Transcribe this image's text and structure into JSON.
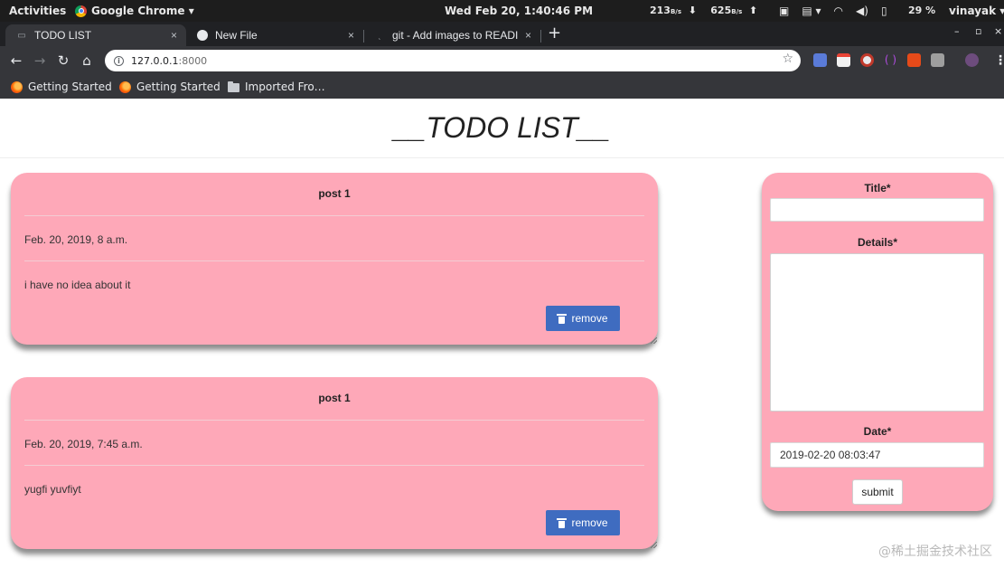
{
  "os_bar": {
    "activities": "Activities",
    "app_name": "Google Chrome ▾",
    "clock": "Wed Feb 20,  1:40:46 PM",
    "net_down": "213",
    "net_up": "625",
    "net_unit": "B/s",
    "battery": "29 %",
    "user": "vinayak ▾"
  },
  "tabs": [
    {
      "label": "TODO LIST",
      "icon": "page-icon",
      "close": "×"
    },
    {
      "label": "New File",
      "icon": "github-icon",
      "close": "×"
    },
    {
      "label": "git - Add images to READI",
      "icon": "loading-icon",
      "close": "×"
    }
  ],
  "new_tab": "+",
  "address_bar": {
    "url_host": "127.0.0.1",
    "url_port": ":8000"
  },
  "bookmarks": [
    {
      "label": "Getting Started",
      "icon": "firefox-icon"
    },
    {
      "label": "Getting Started",
      "icon": "firefox-icon"
    },
    {
      "label": "Imported Fro…",
      "icon": "folder-icon"
    }
  ],
  "page": {
    "title": "__TODO LIST__"
  },
  "posts": [
    {
      "title": "post 1",
      "date": "Feb. 20, 2019, 8 a.m.",
      "details": "i have no idea about it",
      "remove_label": "remove"
    },
    {
      "title": "post 1",
      "date": "Feb. 20, 2019, 7:45 a.m.",
      "details": "yugfi yuvfiyt",
      "remove_label": "remove"
    }
  ],
  "form": {
    "title_label": "Title*",
    "title_value": "",
    "details_label": "Details*",
    "details_value": "",
    "date_label": "Date*",
    "date_value": "2019-02-20 08:03:47",
    "submit_label": "submit"
  },
  "colors": {
    "card_pink": "#fea8b8",
    "remove_blue": "#3f6cc0",
    "chrome_dark": "#35363a",
    "os_bar": "#1d1d1d"
  },
  "watermark": "@稀土掘金技术社区"
}
